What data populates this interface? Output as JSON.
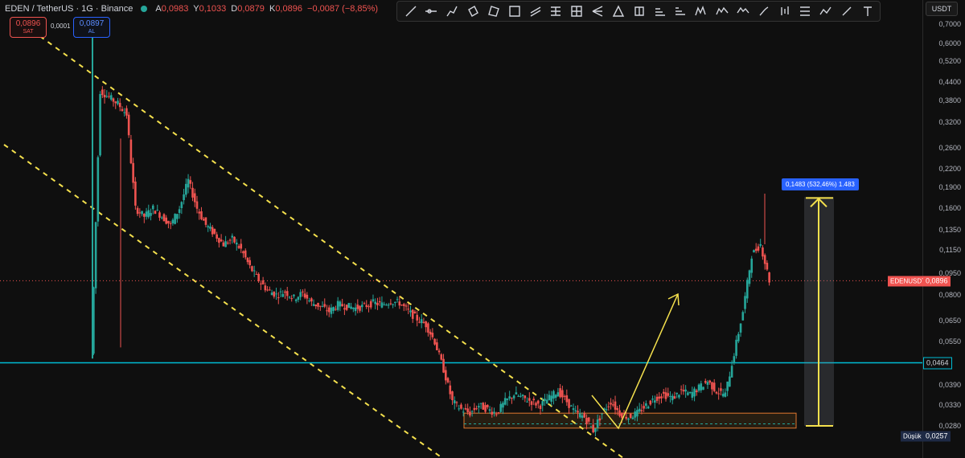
{
  "header": {
    "symbol": "EDEN / TetherUS · 1G · Binance",
    "ohlc": [
      {
        "key": "A",
        "value": "0,0983"
      },
      {
        "key": "Y",
        "value": "0,1033"
      },
      {
        "key": "D",
        "value": "0,0879"
      },
      {
        "key": "K",
        "value": "0,0896"
      },
      {
        "key": "",
        "value": "−0,0087 (−8,85%)"
      }
    ]
  },
  "trade": {
    "sell_price": "0,0896",
    "sell_label": "SAT",
    "spread": "0,0001",
    "buy_price": "0,0897",
    "buy_label": "AL"
  },
  "currency": "USDT",
  "toolbar_icons": [
    "trend-line-icon",
    "horizontal-ray-icon",
    "path-icon",
    "rotated-rectangle-icon",
    "polygon-icon",
    "rectangle-icon",
    "parallel-channel-icon",
    "fib-retracement-icon",
    "grid-icon",
    "pitchfork-icon",
    "triangle-icon",
    "long-position-icon",
    "projection-icon",
    "ruler-icon",
    "xabcd-pattern-icon",
    "elliott-wave-icon",
    "head-shoulders-icon",
    "brush-icon",
    "candlestick-icon",
    "price-range-icon",
    "path-zigzag-icon",
    "pen-icon",
    "text-icon"
  ],
  "tags": {
    "current_price": "0,0896",
    "current_symbol": "EDENUSDT",
    "level_price": "0,0464",
    "low_label": "Düşük",
    "low_price": "0,0257"
  },
  "measure": {
    "label": "0,1483 (532,46%) 1.483"
  },
  "colors": {
    "up": "#26a69a",
    "down": "#ef5350",
    "channel": "#f4e04d",
    "level": "#00bcd4",
    "arrow": "#f4e04d"
  },
  "chart_data": {
    "type": "candlestick",
    "y_scale": "log",
    "y_ticks": [
      "0,7000",
      "0,6000",
      "0,5200",
      "0,4400",
      "0,3800",
      "0,3200",
      "0,2600",
      "0,2200",
      "0,1900",
      "0,1600",
      "0,1350",
      "0,1150",
      "0,0950",
      "0,0800",
      "0,0650",
      "0,0550",
      "0,0390",
      "0,0330",
      "0,0280"
    ],
    "close_points": [
      [
        0,
        0.05
      ],
      [
        1,
        0.41
      ],
      [
        2,
        0.39
      ],
      [
        3,
        0.37
      ],
      [
        4,
        0.34
      ],
      [
        5,
        0.16
      ],
      [
        6,
        0.15
      ],
      [
        7,
        0.16
      ],
      [
        8,
        0.15
      ],
      [
        9,
        0.14
      ],
      [
        10,
        0.16
      ],
      [
        11,
        0.2
      ],
      [
        12,
        0.16
      ],
      [
        13,
        0.14
      ],
      [
        14,
        0.13
      ],
      [
        15,
        0.12
      ],
      [
        16,
        0.125
      ],
      [
        17,
        0.115
      ],
      [
        18,
        0.1
      ],
      [
        19,
        0.09
      ],
      [
        20,
        0.083
      ],
      [
        21,
        0.08
      ],
      [
        22,
        0.082
      ],
      [
        23,
        0.078
      ],
      [
        24,
        0.081
      ],
      [
        25,
        0.075
      ],
      [
        26,
        0.073
      ],
      [
        27,
        0.07
      ],
      [
        28,
        0.074
      ],
      [
        29,
        0.073
      ],
      [
        30,
        0.072
      ],
      [
        31,
        0.073
      ],
      [
        32,
        0.075
      ],
      [
        33,
        0.074
      ],
      [
        34,
        0.076
      ],
      [
        35,
        0.075
      ],
      [
        36,
        0.07
      ],
      [
        37,
        0.066
      ],
      [
        38,
        0.063
      ],
      [
        39,
        0.055
      ],
      [
        40,
        0.044
      ],
      [
        41,
        0.034
      ],
      [
        42,
        0.032
      ],
      [
        43,
        0.031
      ],
      [
        44,
        0.033
      ],
      [
        45,
        0.032
      ],
      [
        46,
        0.031
      ],
      [
        47,
        0.034
      ],
      [
        48,
        0.036
      ],
      [
        49,
        0.035
      ],
      [
        50,
        0.034
      ],
      [
        51,
        0.033
      ],
      [
        52,
        0.035
      ],
      [
        53,
        0.037
      ],
      [
        54,
        0.034
      ],
      [
        55,
        0.031
      ],
      [
        56,
        0.03
      ],
      [
        57,
        0.027
      ],
      [
        58,
        0.031
      ],
      [
        59,
        0.034
      ],
      [
        60,
        0.031
      ],
      [
        61,
        0.03
      ],
      [
        62,
        0.031
      ],
      [
        63,
        0.033
      ],
      [
        64,
        0.035
      ],
      [
        65,
        0.036
      ],
      [
        66,
        0.035
      ],
      [
        67,
        0.037
      ],
      [
        68,
        0.036
      ],
      [
        69,
        0.038
      ],
      [
        70,
        0.04
      ],
      [
        71,
        0.037
      ],
      [
        72,
        0.036
      ],
      [
        73,
        0.05
      ],
      [
        74,
        0.07
      ],
      [
        75,
        0.11
      ],
      [
        76,
        0.12
      ],
      [
        77,
        0.09
      ]
    ],
    "channel": {
      "upper": [
        [
          0.31,
          1.0
        ],
        [
          0.75,
          0.028
        ]
      ],
      "lower": [
        [
          0.0,
          0.26
        ],
        [
          0.48,
          0.022
        ]
      ]
    },
    "level": 0.0464,
    "support_zone": [
      0.0275,
      0.031
    ],
    "measure_range": [
      0.028,
      0.175
    ]
  }
}
